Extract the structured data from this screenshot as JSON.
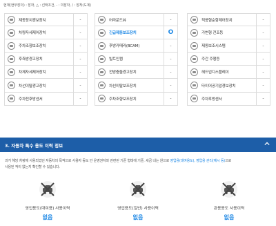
{
  "note": "현재(현부장의) : 장착, △ : 선택조건, - : 미장착, / : 장착(도계)",
  "options": {
    "col1": [
      {
        "label": "제동장치경보장치",
        "value": "-",
        "icon": "abs-icon"
      },
      {
        "label": "차량자세제어장치",
        "value": "-",
        "icon": "esc-icon"
      },
      {
        "label": "주차조향보조장치",
        "value": "-",
        "icon": "parking-icon"
      },
      {
        "label": "후측방경고장치",
        "value": "-",
        "icon": "blindspot-icon"
      },
      {
        "label": "차체자세제어장치",
        "value": "-",
        "icon": "vehicle-icon"
      },
      {
        "label": "차선이탈경고장치",
        "value": "-",
        "icon": "lane-icon"
      },
      {
        "label": "주차전후방센서",
        "value": "-",
        "icon": "sensor-icon"
      }
    ],
    "col2": [
      {
        "label": "어라운드뷰",
        "value": "-",
        "icon": "camera-icon"
      },
      {
        "label": "긴급제동보조장치",
        "value": "O",
        "icon": "brake-icon",
        "highlight": true
      },
      {
        "label": "후방카메라(BCAM)",
        "value": "-",
        "icon": "rear-camera-icon"
      },
      {
        "label": "빌트인캠",
        "value": "-",
        "icon": "builtin-cam-icon"
      },
      {
        "label": "전방충돌경고장치",
        "value": "-",
        "icon": "collision-icon"
      },
      {
        "label": "차선이탈보조장치",
        "value": "-",
        "icon": "lane-assist-icon"
      },
      {
        "label": "주차조향보조장치",
        "value": "-",
        "icon": "steering-icon"
      }
    ],
    "col3": [
      {
        "label": "적응형순항제어장치",
        "value": "-",
        "icon": "cruise-icon"
      },
      {
        "label": "가변형 전조등",
        "value": "-",
        "icon": "headlamp-icon"
      },
      {
        "label": "제동보조시스템",
        "value": "-",
        "icon": "brake-assist-icon"
      },
      {
        "label": "주간 주행등",
        "value": "-",
        "icon": "drl-icon"
      },
      {
        "label": "헤드업디스플레이",
        "value": "-",
        "icon": "hud-icon"
      },
      {
        "label": "타이어공기압경보장치",
        "value": "-",
        "icon": "tire-icon"
      },
      {
        "label": "주차후방센서",
        "value": "-",
        "icon": "rear-sensor-icon"
      }
    ]
  },
  "section": {
    "title": "3. 자동차 특수 용도 이력 정보"
  },
  "description": {
    "text1": "과거 해당 차량에 사용되었던 자동차의 목적으로 사용자 등도 안 운영권자와 관련된 기준 형태에 기준, 세금 내는 원으로 ",
    "link1": "영업용(대여용도), 영업용 관리(예시 등)",
    "text2": "으로",
    "text3": "사용된 적이 없는지 확인할 수 있습니다."
  },
  "usage": [
    {
      "label": "영업용도(대여용) 사용이력",
      "value": "없음",
      "icon": "rental-car-icon"
    },
    {
      "label": "영업용도(일반) 사용이력",
      "value": "없음",
      "icon": "business-car-icon"
    },
    {
      "label": "관용용도 사용이력",
      "value": "없음",
      "icon": "government-car-icon"
    }
  ],
  "colors": {
    "accent": "#1e88e5",
    "bar": "#1d5ea8"
  }
}
